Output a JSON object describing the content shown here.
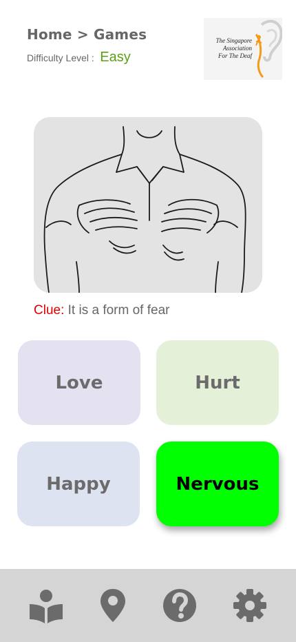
{
  "header": {
    "breadcrumb": "Home > Games",
    "difficulty_label": "Difficulty Level :",
    "difficulty_value": "Easy"
  },
  "logo": {
    "line1": "The Singapore",
    "line2": "Association",
    "line3": "For The Deaf"
  },
  "game": {
    "clue_label": "Clue:",
    "clue_text": "It is a form of fear",
    "options": [
      {
        "label": "Love",
        "selected": false
      },
      {
        "label": "Hurt",
        "selected": false
      },
      {
        "label": "Happy",
        "selected": false
      },
      {
        "label": "Nervous",
        "selected": true
      }
    ]
  },
  "colors": {
    "selected_option": "#00ff00",
    "clue_label": "#e00000",
    "difficulty_value": "#5aa010"
  },
  "nav": {
    "icons": [
      "book-reader-icon",
      "map-marker-icon",
      "question-circle-icon",
      "gear-icon"
    ]
  }
}
